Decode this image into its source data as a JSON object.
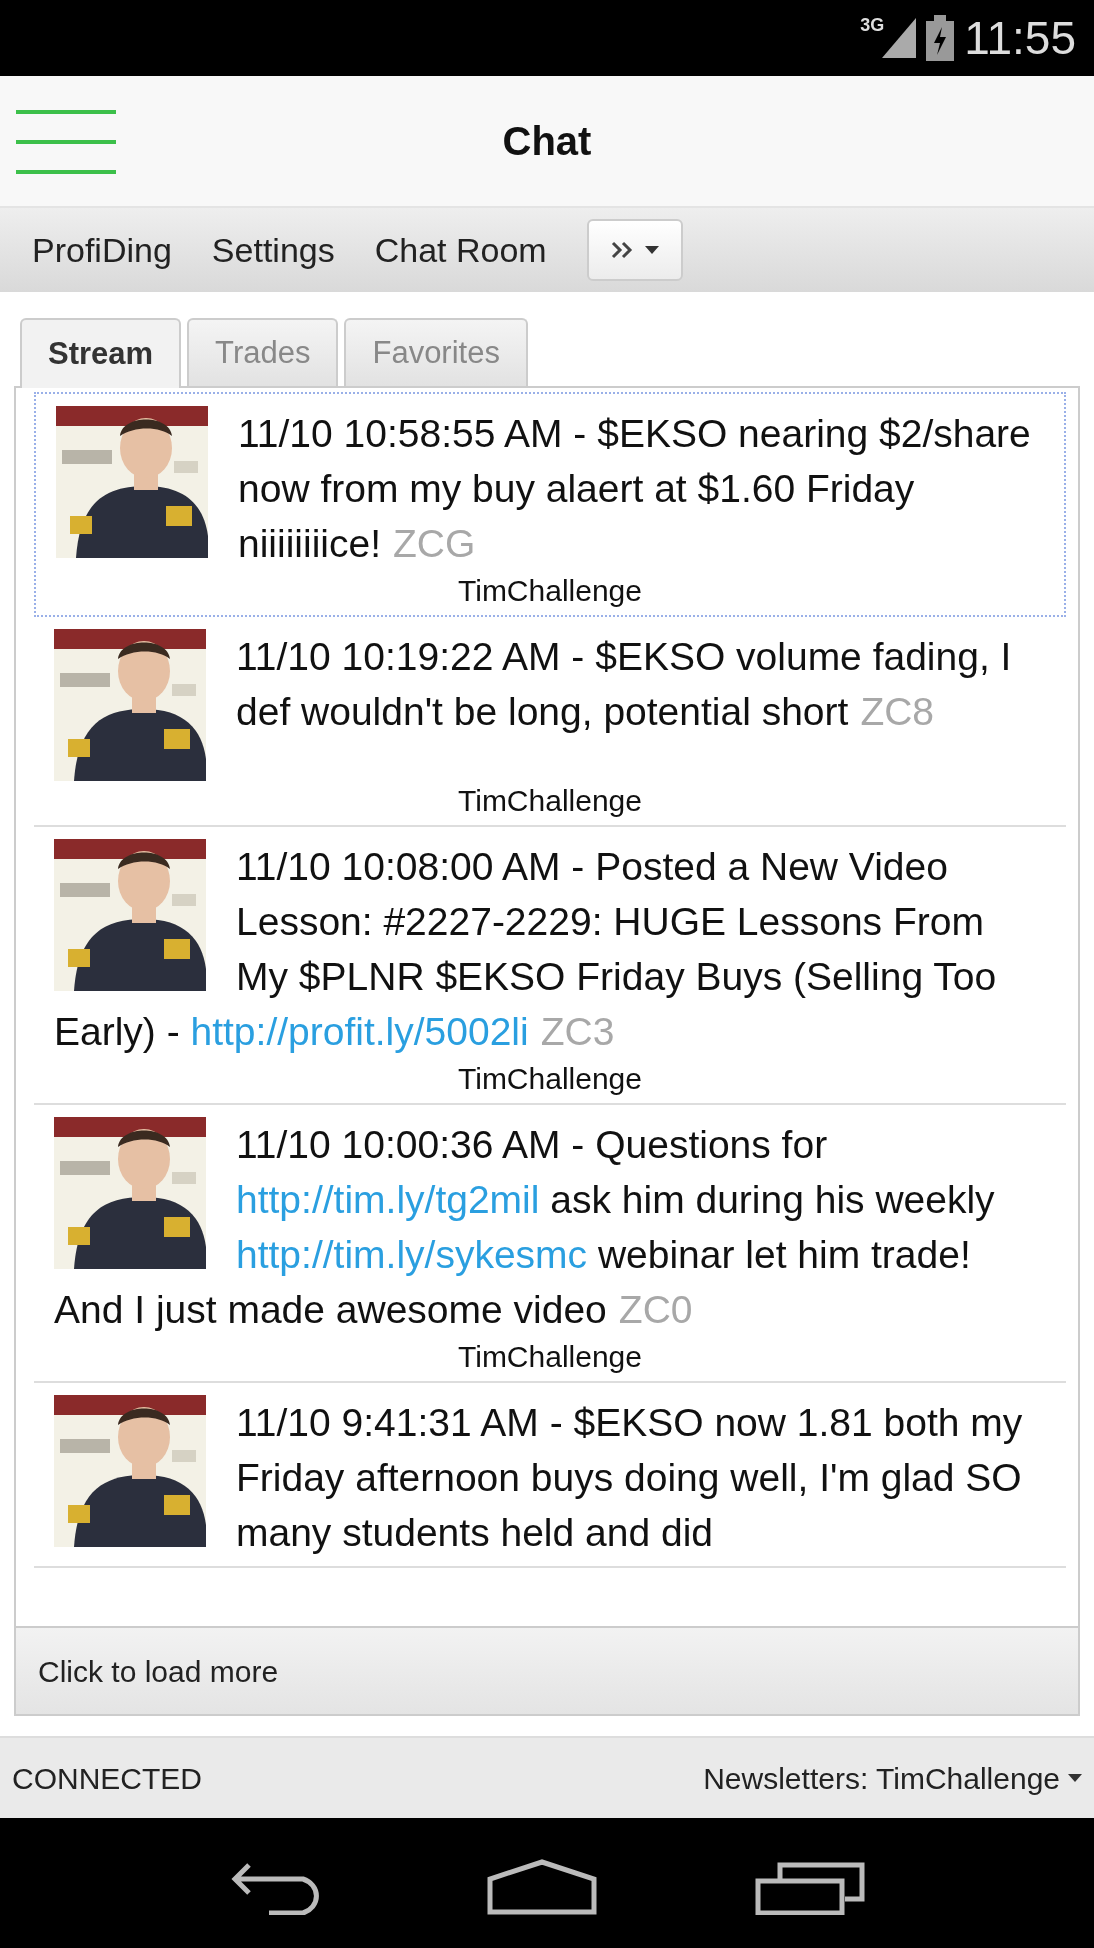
{
  "status_bar": {
    "network": "3G",
    "time": "11:55"
  },
  "header": {
    "title": "Chat"
  },
  "nav": {
    "items": [
      "ProfiDing",
      "Settings",
      "Chat Room"
    ]
  },
  "tabs": [
    {
      "label": "Stream",
      "selected": true
    },
    {
      "label": "Trades",
      "selected": false
    },
    {
      "label": "Favorites",
      "selected": false
    }
  ],
  "messages": [
    {
      "selected": true,
      "parts": [
        {
          "kind": "text",
          "text": "11/10 10:58:55 AM - $EKSO nearing $2/share now from my buy alaert at $1.60 Friday niiiiiiiice!"
        }
      ],
      "tag": "ZCG",
      "author": "TimChallenge"
    },
    {
      "selected": false,
      "parts": [
        {
          "kind": "text",
          "text": "11/10 10:19:22 AM - $EKSO volume fading, I def wouldn't be long, potential short"
        }
      ],
      "tag": "ZC8",
      "author": "TimChallenge"
    },
    {
      "selected": false,
      "parts": [
        {
          "kind": "text",
          "text": "11/10 10:08:00 AM - Posted a New Video Lesson: #2227-2229: HUGE Lessons From My $PLNR $EKSO Friday Buys (Selling Too Early) - "
        },
        {
          "kind": "link",
          "text": "http://profit.ly/5002li"
        }
      ],
      "tag": "ZC3",
      "author": "TimChallenge"
    },
    {
      "selected": false,
      "parts": [
        {
          "kind": "text",
          "text": "11/10 10:00:36 AM - Questions for "
        },
        {
          "kind": "link",
          "text": "http://tim.ly/tg2mil"
        },
        {
          "kind": "text",
          "text": " ask him during his weekly "
        },
        {
          "kind": "link",
          "text": "http://tim.ly/sykesmc"
        },
        {
          "kind": "text",
          "text": " webinar let him trade! And I just made awesome video"
        }
      ],
      "tag": "ZC0",
      "author": "TimChallenge"
    },
    {
      "selected": false,
      "parts": [
        {
          "kind": "text",
          "text": "11/10 9:41:31 AM - $EKSO now 1.81 both my Friday afternoon buys doing well, I'm glad SO many students held and did"
        }
      ]
    }
  ],
  "load_more": "Click to load more",
  "footer": {
    "connection": "CONNECTED",
    "newsletters": "Newsletters: TimChallenge"
  }
}
